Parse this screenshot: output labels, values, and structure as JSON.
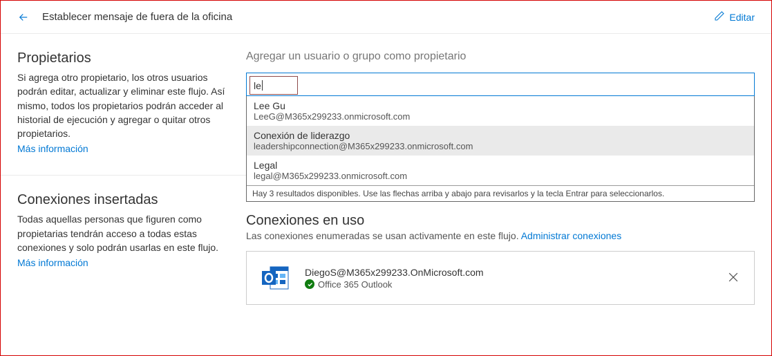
{
  "header": {
    "title": "Establecer mensaje de fuera de la oficina",
    "edit_label": "Editar"
  },
  "sidebar": {
    "owners": {
      "title": "Propietarios",
      "description": "Si agrega otro propietario, los otros usuarios podrán editar, actualizar y eliminar este flujo. Así mismo, todos los propietarios podrán acceder al historial de ejecución y agregar o quitar otros propietarios.",
      "more_info": "Más información"
    },
    "embedded": {
      "title": "Conexiones insertadas",
      "description": "Todas aquellas personas que figuren como propietarias tendrán acceso a todas estas conexiones y solo podrán usarlas en este flujo.",
      "more_info": "Más información"
    }
  },
  "main": {
    "add_owner_header": "Agregar un usuario o grupo como propietario",
    "search_value": "le",
    "suggestions": [
      {
        "name": "Lee Gu",
        "email": "LeeG@M365x299233.onmicrosoft.com"
      },
      {
        "name": "Conexión de liderazgo",
        "email": "leadershipconnection@M365x299233.onmicrosoft.com"
      },
      {
        "name": "Legal",
        "email": "legal@M365x299233.onmicrosoft.com"
      }
    ],
    "suggestions_footer": "Hay 3 resultados disponibles. Use las flechas arriba y abajo para revisarlos y la tecla Entrar para seleccionarlos.",
    "connections": {
      "title": "Conexiones en uso",
      "description": "Las conexiones enumeradas se usan activamente en este flujo. ",
      "manage_link": "Administrar conexiones",
      "items": [
        {
          "email": "DiegoS@M365x299233.OnMicrosoft.com",
          "service": "Office 365 Outlook"
        }
      ]
    }
  }
}
